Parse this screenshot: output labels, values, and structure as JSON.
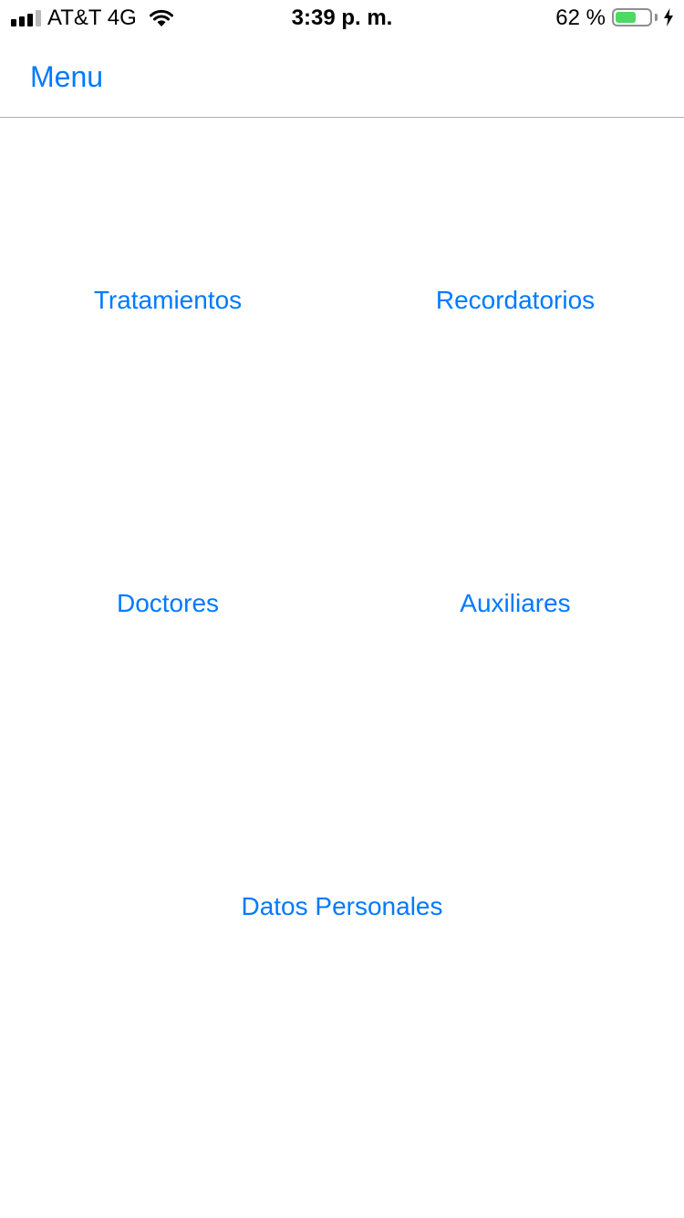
{
  "status_bar": {
    "carrier": "AT&T 4G",
    "time": "3:39 p. m.",
    "battery_percent": "62 %",
    "battery_level": 0.62,
    "signal_bars": 3,
    "signal_bars_max": 4
  },
  "nav": {
    "back_label": "Menu"
  },
  "menu": {
    "items": [
      {
        "label": "Tratamientos"
      },
      {
        "label": "Recordatorios"
      },
      {
        "label": "Doctores"
      },
      {
        "label": "Auxiliares"
      },
      {
        "label": "Datos Personales"
      }
    ]
  },
  "colors": {
    "accent": "#007aff",
    "battery_green": "#4cd964",
    "separator": "#b2b2b2"
  }
}
